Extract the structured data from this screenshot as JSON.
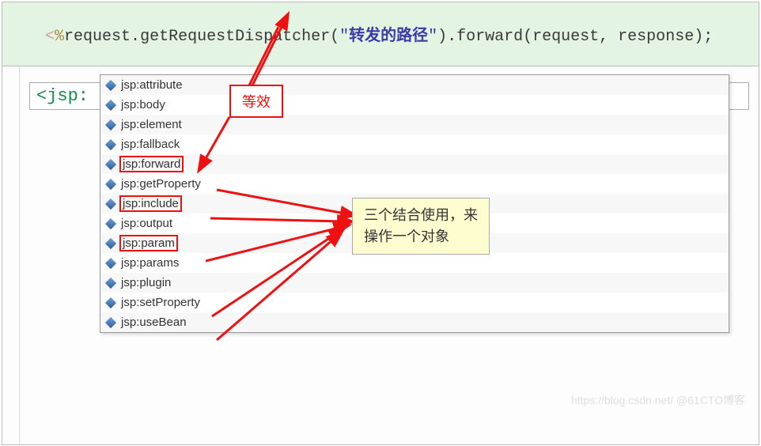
{
  "code": {
    "open": "<",
    "pct": "%",
    "prefix": "request.getRequestDispatcher(",
    "q1": "\"",
    "str": "转发的路径",
    "q2": "\"",
    "suffix": ").forward(request, response);"
  },
  "tag": "<jsp:",
  "items": [
    {
      "label": "jsp:attribute",
      "hl": false
    },
    {
      "label": "jsp:body",
      "hl": false
    },
    {
      "label": "jsp:element",
      "hl": false
    },
    {
      "label": "jsp:fallback",
      "hl": false
    },
    {
      "label": "jsp:forward",
      "hl": true
    },
    {
      "label": "jsp:getProperty",
      "hl": false
    },
    {
      "label": "jsp:include",
      "hl": true
    },
    {
      "label": "jsp:output",
      "hl": false
    },
    {
      "label": "jsp:param",
      "hl": true
    },
    {
      "label": "jsp:params",
      "hl": false
    },
    {
      "label": "jsp:plugin",
      "hl": false
    },
    {
      "label": "jsp:setProperty",
      "hl": false
    },
    {
      "label": "jsp:useBean",
      "hl": false
    }
  ],
  "annot1": "等效",
  "annot2_line1": "三个结合使用，来",
  "annot2_line2": "操作一个对象",
  "watermark": "https://blog.csdn.net/ @61CTO博客"
}
